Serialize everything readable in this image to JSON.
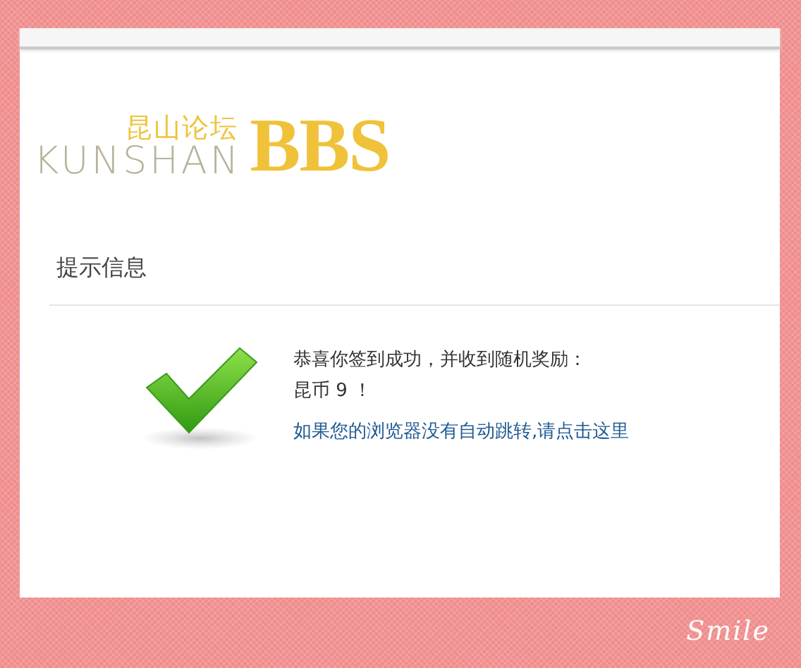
{
  "logo": {
    "chinese_name": "昆山论坛",
    "latin_name": "KUNSHAN",
    "mark": "BBS"
  },
  "notice": {
    "title": "提示信息",
    "messages": [
      "恭喜你签到成功，并收到随机奖励：",
      "昆币 9 ！"
    ],
    "link": "如果您的浏览器没有自动跳转,请点击这里"
  },
  "frame_caption": "Smile"
}
